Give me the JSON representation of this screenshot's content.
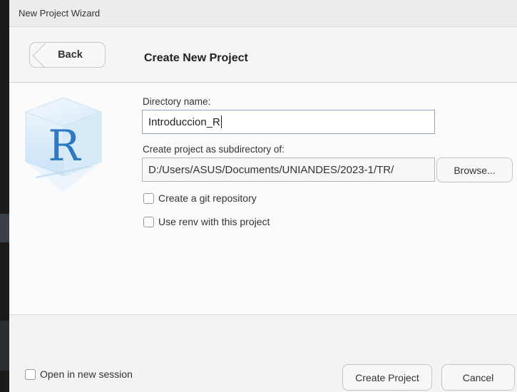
{
  "window": {
    "title": "New Project Wizard"
  },
  "header": {
    "back_label": "Back",
    "title": "Create New Project"
  },
  "form": {
    "directory_name_label": "Directory name:",
    "directory_name_value": "Introduccion_R",
    "subdirectory_label": "Create project as subdirectory of:",
    "subdirectory_value": "D:/Users/ASUS/Documents/UNIANDES/2023-1/TR/",
    "browse_label": "Browse...",
    "git_label": "Create a git repository",
    "renv_label": "Use renv with this project"
  },
  "footer": {
    "open_session_label": "Open in new session",
    "create_label": "Create Project",
    "cancel_label": "Cancel"
  },
  "logo": {
    "letter": "R",
    "icon": "r-logo-icon"
  },
  "colors": {
    "accent_border": "#8aa7c8",
    "logo_blue": "#2f78c4"
  }
}
